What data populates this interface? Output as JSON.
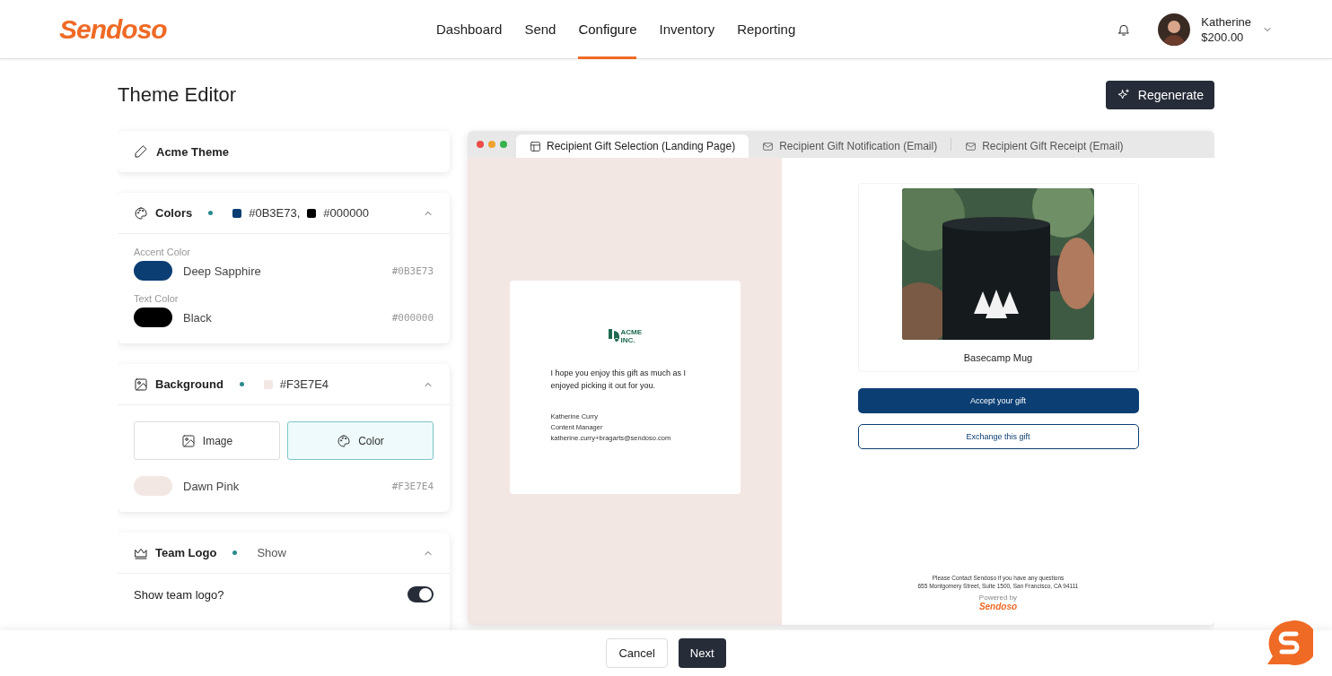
{
  "header": {
    "logo": "Sendoso",
    "nav": [
      {
        "label": "Dashboard",
        "selected": false
      },
      {
        "label": "Send",
        "selected": false
      },
      {
        "label": "Configure",
        "selected": true
      },
      {
        "label": "Inventory",
        "selected": false
      },
      {
        "label": "Reporting",
        "selected": false
      }
    ],
    "user": {
      "name": "Katherine",
      "balance": "$200.00"
    }
  },
  "page": {
    "title": "Theme Editor",
    "regenerate": "Regenerate"
  },
  "theme_name": "Acme Theme",
  "sections": [
    {
      "kind": "colors",
      "title": "Colors",
      "expanded": true,
      "summary": [
        {
          "color": "#0b3e73",
          "text": "#0B3E73,"
        },
        {
          "color": "#000000",
          "text": "#000000"
        }
      ],
      "fields": [
        {
          "label": "Accent Color",
          "name": "Deep Sapphire",
          "hex": "#0B3E73",
          "color": "#0b3e73"
        },
        {
          "label": "Text Color",
          "name": "Black",
          "hex": "#000000",
          "color": "#000000"
        }
      ]
    },
    {
      "kind": "background",
      "title": "Background",
      "expanded": true,
      "summary": [
        {
          "color": "#f3e7e4",
          "text": "#F3E7E4"
        }
      ],
      "options": [
        {
          "label": "Image",
          "selected": false
        },
        {
          "label": "Color",
          "selected": true
        }
      ],
      "fields": [
        {
          "name": "Dawn Pink",
          "hex": "#F3E7E4",
          "color": "#f3e7e4"
        }
      ]
    },
    {
      "kind": "logo",
      "title": "Team Logo",
      "expanded": true,
      "summary_text": "Show",
      "toggle": {
        "label": "Show team logo?",
        "on": true
      }
    }
  ],
  "preview": {
    "tabs": [
      {
        "label": "Recipient Gift Selection (Landing Page)",
        "kind": "page",
        "selected": true
      },
      {
        "label": "Recipient Gift Notification (Email)",
        "kind": "email",
        "selected": false
      },
      {
        "label": "Recipient Gift Receipt (Email)",
        "kind": "email",
        "selected": false
      }
    ],
    "note": {
      "logo": "ACME INC.",
      "message": "I hope you enjoy this gift as much as I enjoyed picking it out for you.",
      "signature": [
        "Katherine Curry",
        "Content Manager",
        "katherine.curry+bragarts@sendoso.com"
      ]
    },
    "product": {
      "name": "Basecamp Mug"
    },
    "buttons": [
      "Accept your gift",
      "Exchange this gift"
    ],
    "footer": {
      "contact": "Please Contact Sendoso if you have any questions",
      "address": "655 Montgomery Street, Suite 1500, San Francisco, CA 94111",
      "powered": "Powered by",
      "brand": "Sendoso"
    }
  },
  "footer_buttons": [
    "Cancel",
    "Next"
  ]
}
